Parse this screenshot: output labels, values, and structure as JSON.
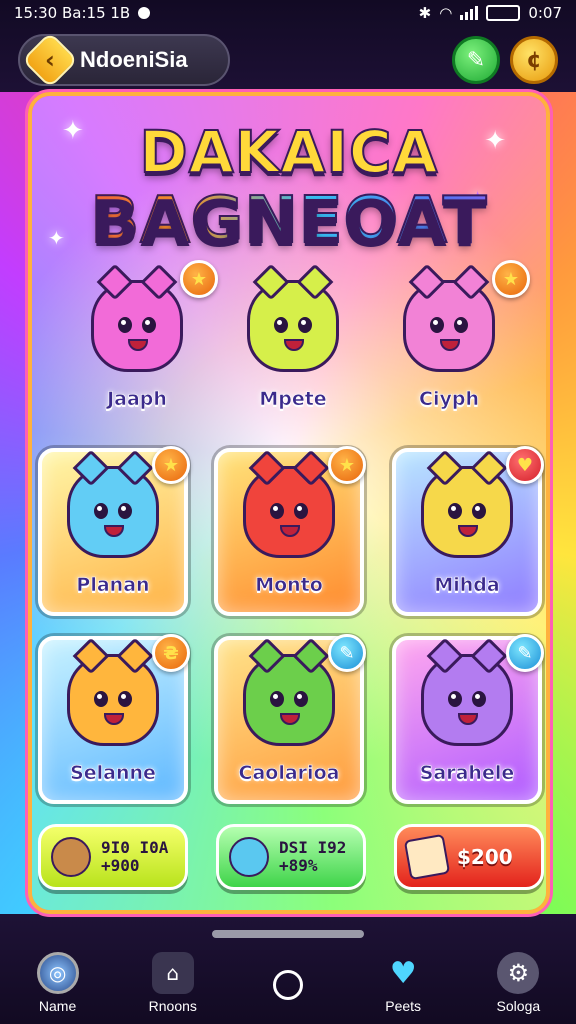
{
  "status_bar": {
    "time_left": "15:30 Ba:15 1B",
    "time_right": "0:07"
  },
  "header": {
    "back_label": "NdoeniSia"
  },
  "banner": {
    "line1": "DAKAICA",
    "line2": "BAGNEOAT"
  },
  "cards": [
    {
      "name": "Jaaph",
      "color": "#f26bd8",
      "badge": "★",
      "badge_color": "orange"
    },
    {
      "name": "Mpete",
      "color": "#d6ef4a",
      "badge": "",
      "badge_color": ""
    },
    {
      "name": "Ciyph",
      "color": "#f282d6",
      "badge": "★",
      "badge_color": "orange"
    },
    {
      "name": "Planan",
      "color": "#62cdf5",
      "badge": "★",
      "badge_color": "orange"
    },
    {
      "name": "Monto",
      "color": "#f0443c",
      "badge": "★",
      "badge_color": "orange"
    },
    {
      "name": "Mihda",
      "color": "#f6d84a",
      "badge": "♥",
      "badge_color": "red"
    },
    {
      "name": "Selanne",
      "color": "#ffb63d",
      "badge": "₴",
      "badge_color": "orange"
    },
    {
      "name": "Caolarioa",
      "color": "#6ccf4b",
      "badge": "✎",
      "badge_color": "blue"
    },
    {
      "name": "Sarahele",
      "color": "#b37cf0",
      "badge": "✎",
      "badge_color": "blue"
    }
  ],
  "rewards": [
    {
      "line1": "9I0 I0A",
      "line2": "+900"
    },
    {
      "line1": "DSI I92",
      "line2": "+89%"
    },
    {
      "line1": "$200",
      "line2": ""
    }
  ],
  "bottom_nav": [
    {
      "label": "Name"
    },
    {
      "label": "Rnoons"
    },
    {
      "label": ""
    },
    {
      "label": "Peets"
    },
    {
      "label": "Sologa"
    }
  ]
}
